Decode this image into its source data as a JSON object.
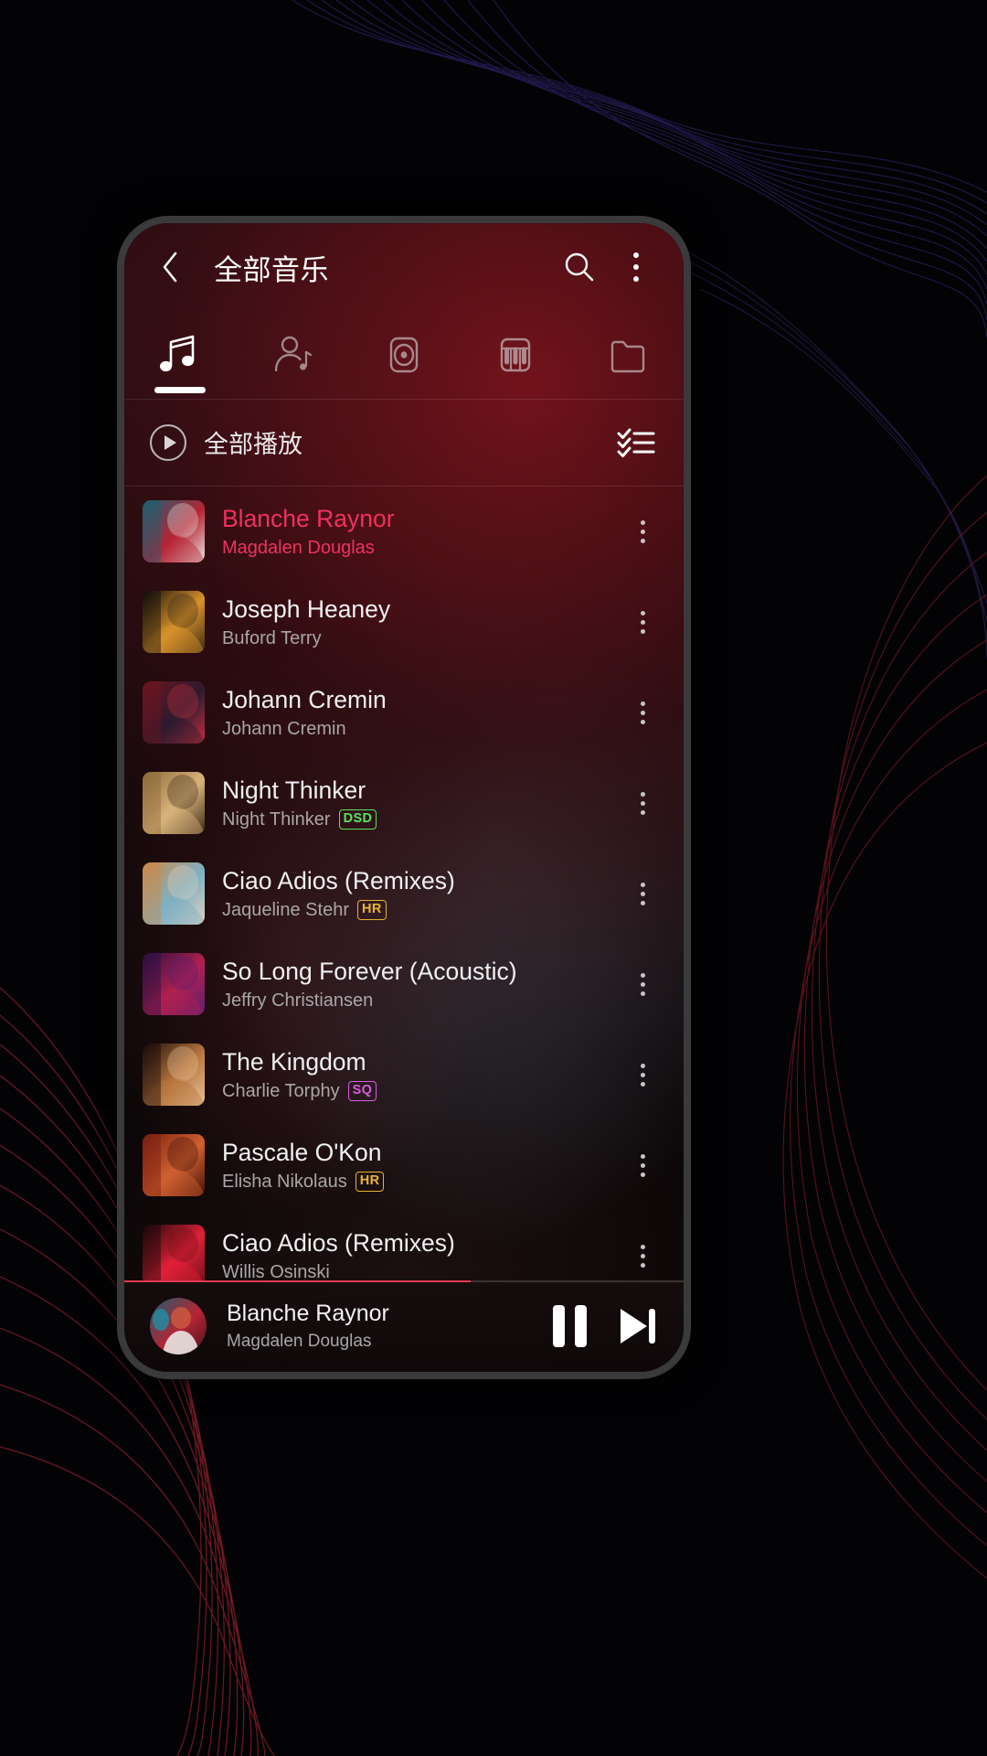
{
  "app": {
    "header": {
      "title": "全部音乐",
      "back_icon": "chevron-left-icon",
      "search_icon": "search-icon",
      "overflow_icon": "more-vertical-icon"
    },
    "tabs": [
      {
        "name": "songs",
        "icon": "music-note-icon",
        "active": true
      },
      {
        "name": "artists",
        "icon": "artist-icon",
        "active": false
      },
      {
        "name": "albums",
        "icon": "album-disc-icon",
        "active": false
      },
      {
        "name": "genres",
        "icon": "piano-keys-icon",
        "active": false
      },
      {
        "name": "folders",
        "icon": "folder-icon",
        "active": false
      }
    ],
    "play_all": {
      "label": "全部播放",
      "play_icon": "play-circle-icon",
      "multiselect_icon": "checklist-icon"
    },
    "tracks": [
      {
        "title": "Blanche Raynor",
        "artist": "Magdalen Douglas",
        "badge": "",
        "active": true,
        "art": [
          "#1b5f70",
          "#b62434",
          "#e8e4e2"
        ]
      },
      {
        "title": "Joseph Heaney",
        "artist": "Buford Terry",
        "badge": "",
        "active": false,
        "art": [
          "#120d0a",
          "#d8922c",
          "#3c2a16"
        ]
      },
      {
        "title": "Johann Cremin",
        "artist": "Johann Cremin",
        "badge": "",
        "active": false,
        "art": [
          "#6d1420",
          "#2d1a2e",
          "#c43040"
        ]
      },
      {
        "title": "Night Thinker",
        "artist": "Night Thinker",
        "badge": "DSD",
        "active": false,
        "art": [
          "#8c6a3a",
          "#d8b27a",
          "#3a2a18"
        ]
      },
      {
        "title": "Ciao Adios (Remixes)",
        "artist": "Jaqueline Stehr",
        "badge": "HR",
        "active": false,
        "art": [
          "#c98a4a",
          "#7fb0c4",
          "#e0d2c0"
        ]
      },
      {
        "title": "So Long Forever (Acoustic)",
        "artist": "Jeffry Christiansen",
        "badge": "",
        "active": false,
        "art": [
          "#2a1040",
          "#b02050",
          "#5a2070"
        ]
      },
      {
        "title": "The Kingdom",
        "artist": "Charlie Torphy",
        "badge": "SQ",
        "active": false,
        "art": [
          "#1a0c0a",
          "#b8763e",
          "#e8c49a"
        ]
      },
      {
        "title": "Pascale O'Kon",
        "artist": "Elisha Nikolaus",
        "badge": "HR",
        "active": false,
        "art": [
          "#7a2010",
          "#d06030",
          "#401008"
        ]
      },
      {
        "title": "Ciao Adios (Remixes)",
        "artist": "Willis Osinski",
        "badge": "",
        "active": false,
        "art": [
          "#180808",
          "#e02038",
          "#701018"
        ]
      }
    ],
    "mini_player": {
      "title": "Blanche Raynor",
      "artist": "Magdalen Douglas",
      "pause_icon": "pause-icon",
      "next_icon": "skip-next-icon",
      "progress_percent": 62
    },
    "colors": {
      "accent": "#f0315e",
      "progress": "#e03a52",
      "badge_dsd": "#5ae35a",
      "badge_hr": "#e8b430",
      "badge_sq": "#d85ce0"
    }
  }
}
